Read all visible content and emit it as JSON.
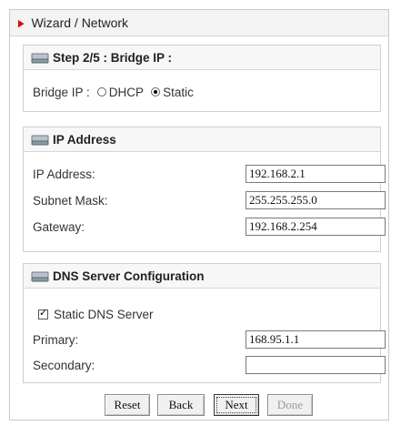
{
  "header": {
    "title": "Wizard / Network"
  },
  "step": {
    "title": "Step 2/5 : Bridge IP :",
    "bridge_ip_label": "Bridge IP :",
    "options": [
      {
        "label": "DHCP",
        "selected": false
      },
      {
        "label": "Static",
        "selected": true
      }
    ]
  },
  "ip_section": {
    "title": "IP Address",
    "fields": [
      {
        "label": "IP Address:",
        "value": "192.168.2.1"
      },
      {
        "label": "Subnet Mask:",
        "value": "255.255.255.0"
      },
      {
        "label": "Gateway:",
        "value": "192.168.2.254"
      }
    ]
  },
  "dns_section": {
    "title": "DNS Server Configuration",
    "static_dns_label": "Static DNS Server",
    "static_dns_checked": true,
    "fields": [
      {
        "label": "Primary:",
        "value": "168.95.1.1"
      },
      {
        "label": "Secondary:",
        "value": ""
      }
    ]
  },
  "buttons": {
    "reset": "Reset",
    "back": "Back",
    "next": "Next",
    "done": "Done"
  },
  "colors": {
    "accent_arrow": "#cc1111",
    "border": "#cfcfcf"
  },
  "icons": {
    "section": "hard-drive-icon",
    "title": "right-arrow-icon"
  }
}
